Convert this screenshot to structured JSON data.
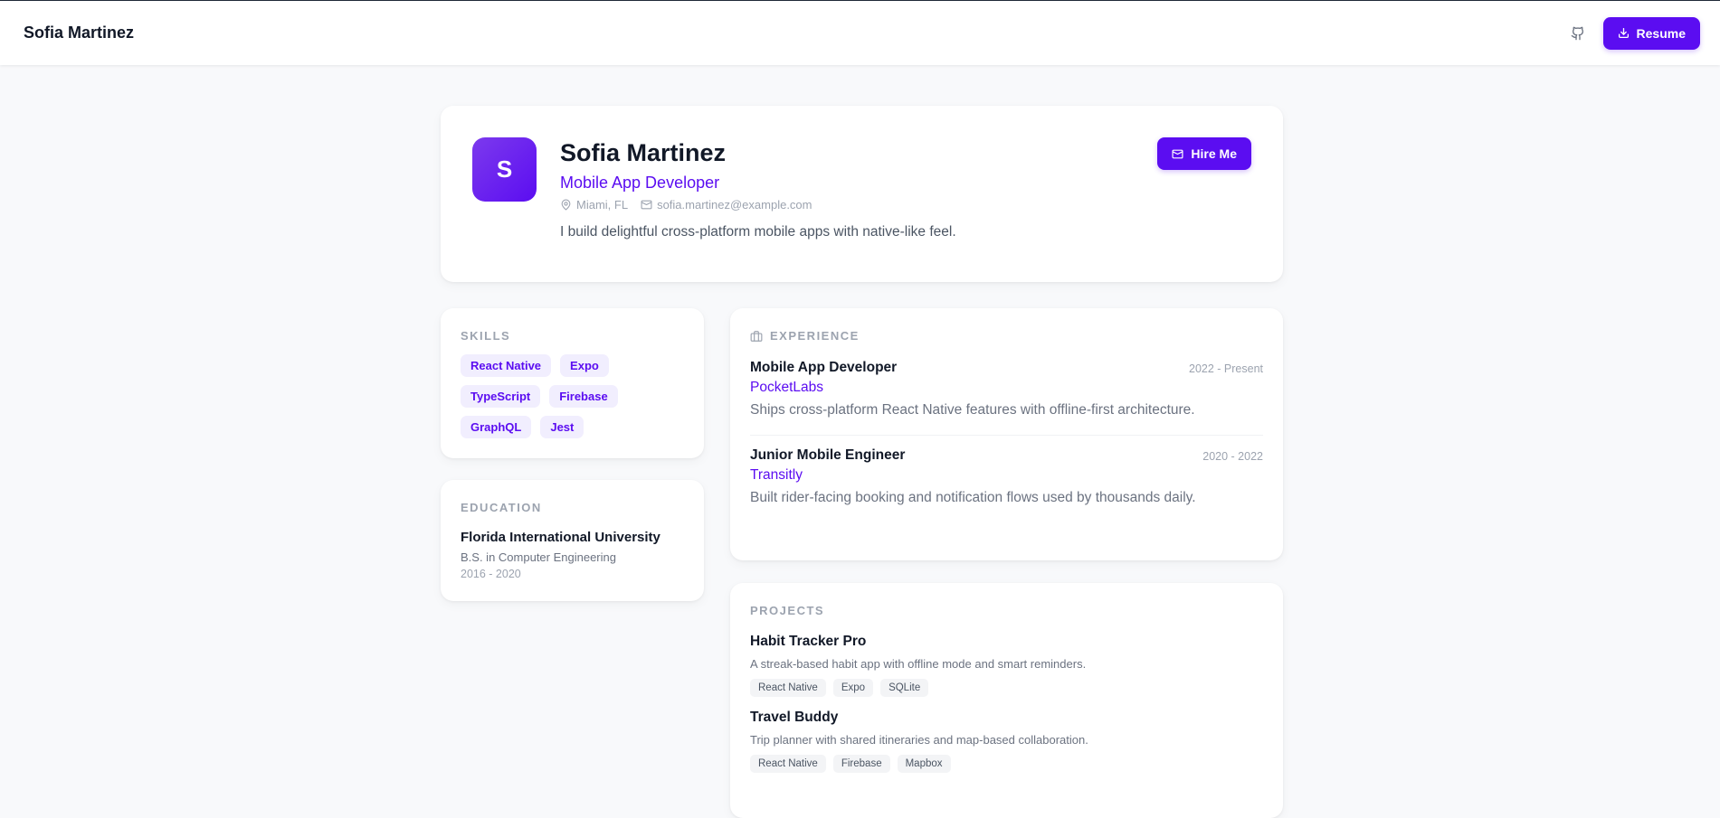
{
  "header": {
    "brand": "Sofia Martinez",
    "github_icon": "github-icon",
    "resume_label": "Resume",
    "resume_icon": "download-icon"
  },
  "hero": {
    "avatar_initial": "S",
    "name": "Sofia Martinez",
    "role": "Mobile App Developer",
    "location": "Miami, FL",
    "email": "sofia.martinez@example.com",
    "bio": "I build delightful cross-platform mobile apps with native-like feel.",
    "hire_label": "Hire Me"
  },
  "skills": {
    "title": "SKILLS",
    "items": [
      "React Native",
      "Expo",
      "TypeScript",
      "Firebase",
      "GraphQL",
      "Jest"
    ]
  },
  "education": {
    "title": "EDUCATION",
    "school": "Florida International University",
    "degree": "B.S. in Computer Engineering",
    "years": "2016 - 2020"
  },
  "experience": {
    "title": "EXPERIENCE",
    "items": [
      {
        "role": "Mobile App Developer",
        "dates": "2022 - Present",
        "company": "PocketLabs",
        "description": "Ships cross-platform React Native features with offline-first architecture."
      },
      {
        "role": "Junior Mobile Engineer",
        "dates": "2020 - 2022",
        "company": "Transitly",
        "description": "Built rider-facing booking and notification flows used by thousands daily."
      }
    ]
  },
  "projects": {
    "title": "PROJECTS",
    "items": [
      {
        "name": "Habit Tracker Pro",
        "description": "A streak-based habit app with offline mode and smart reminders.",
        "tags": [
          "React Native",
          "Expo",
          "SQLite"
        ]
      },
      {
        "name": "Travel Buddy",
        "description": "Trip planner with shared itineraries and map-based collaboration.",
        "tags": [
          "React Native",
          "Firebase",
          "Mapbox"
        ]
      }
    ]
  },
  "colors": {
    "accent": "#5b0df1",
    "background": "#f8f9fb",
    "text": "#111827",
    "muted": "#9ca3af"
  }
}
